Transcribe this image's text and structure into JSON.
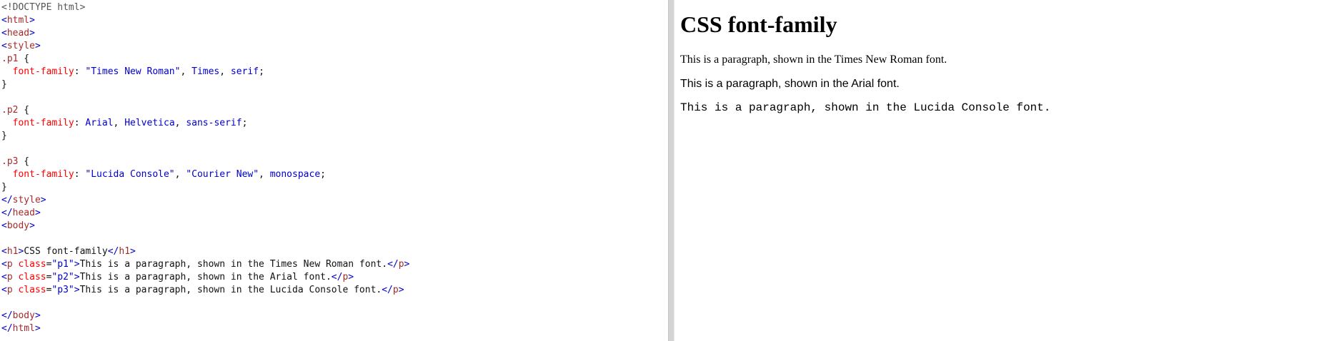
{
  "colors": {
    "tag": "#a52a2a",
    "bracket": "#0000cd",
    "property": "#ff0000",
    "value": "#0000cd",
    "text": "#111111",
    "divider": "#d4d4d4"
  },
  "code": {
    "doctype": "<!DOCTYPE html>",
    "tag_html": "html",
    "tag_head": "head",
    "tag_style": "style",
    "tag_body": "body",
    "tag_h1": "h1",
    "tag_p": "p",
    "css": {
      "p1_selector": ".p1",
      "p2_selector": ".p2",
      "p3_selector": ".p3",
      "open_brace": " {",
      "close_brace": "}",
      "property": "font-family",
      "p1_value_1": "\"Times New Roman\"",
      "p1_value_2": "Times",
      "p1_value_3": "serif",
      "p2_value_1": "Arial",
      "p2_value_2": "Helvetica",
      "p2_value_3": "sans-serif",
      "p3_value_1": "\"Lucida Console\"",
      "p3_value_2": "\"Courier New\"",
      "p3_value_3": "monospace"
    },
    "h1_text": "CSS font-family",
    "attr_class": "class",
    "p1_class": "\"p1\"",
    "p2_class": "\"p2\"",
    "p3_class": "\"p3\"",
    "p1_text": "This is a paragraph, shown in the Times New Roman font.",
    "p2_text": "This is a paragraph, shown in the Arial font.",
    "p3_text": "This is a paragraph, shown in the Lucida Console font."
  },
  "result": {
    "heading": "CSS font-family",
    "p1": "This is a paragraph, shown in the Times New Roman font.",
    "p2": "This is a paragraph, shown in the Arial font.",
    "p3": "This is a paragraph, shown in the Lucida Console font."
  }
}
